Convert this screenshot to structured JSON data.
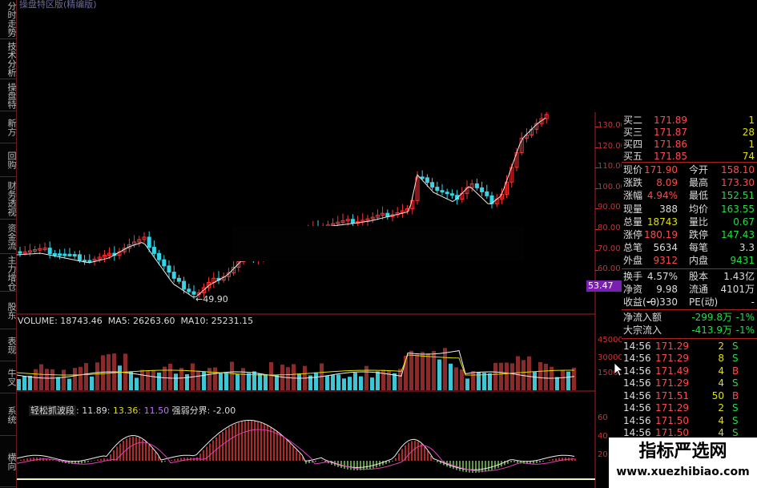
{
  "window": {
    "title": "操盘特区版(精编版)"
  },
  "left_tabs": [
    {
      "label": "分时走势"
    },
    {
      "label": "技术分析",
      "active": true
    },
    {
      "label": "操盘特"
    },
    {
      "label": "新方"
    },
    {
      "label": "回购"
    },
    {
      "label": "财务透视"
    },
    {
      "label": "资金流"
    },
    {
      "label": "主力增仓"
    },
    {
      "label": "股东"
    },
    {
      "label": "表现"
    },
    {
      "label": "牛叉"
    },
    {
      "label": "系统"
    },
    {
      "label": "横向"
    }
  ],
  "price_chart": {
    "y_ticks": [
      "130.00",
      "120.00",
      "110.00",
      "100.00",
      "90.00",
      "80.00",
      "70.00",
      "60.00"
    ],
    "low_label": "49.90",
    "current_marker": "53.47"
  },
  "volume_panel": {
    "label": "VOLUME: 18743.46  MA5: 26263.60  MA10: 25231.15",
    "y_ticks": [
      "45000",
      "30000",
      "15000"
    ]
  },
  "indicator_panel": {
    "name": "轻松抓波段",
    "values": [
      {
        "text": ": 11.89",
        "color": "#dddddd"
      },
      {
        "text": ": 13.36",
        "color": "#e0e000"
      },
      {
        "text": ": 11.50",
        "color": "#c070ff"
      },
      {
        "text": " 强弱分界: -2.00",
        "color": "#dddddd"
      }
    ],
    "y_ticks": [
      "60",
      "40",
      "20"
    ]
  },
  "quote": {
    "bids": [
      {
        "label": "买二",
        "price": "171.89",
        "vol": "1"
      },
      {
        "label": "买三",
        "price": "171.87",
        "vol": "28"
      },
      {
        "label": "买四",
        "price": "171.86",
        "vol": "1"
      },
      {
        "label": "买五",
        "price": "171.85",
        "vol": "74"
      }
    ],
    "stats": [
      {
        "l1": "现价",
        "v1": "171.90",
        "c1": "up",
        "l2": "今开",
        "v2": "158.10",
        "c2": "up"
      },
      {
        "l1": "涨跌",
        "v1": "8.09",
        "c1": "up",
        "l2": "最高",
        "v2": "173.30",
        "c2": "up"
      },
      {
        "l1": "涨幅",
        "v1": "4.94%",
        "c1": "up",
        "l2": "最低",
        "v2": "152.51",
        "c2": "dn"
      },
      {
        "l1": "现量",
        "v1": "388",
        "c1": "wh",
        "l2": "均价",
        "v2": "163.55",
        "c2": "dn"
      },
      {
        "l1": "总量",
        "v1": "18743",
        "c1": "yel",
        "l2": "量比",
        "v2": "0.67",
        "c2": "dn"
      },
      {
        "l1": "涨停",
        "v1": "180.19",
        "c1": "up",
        "l2": "跌停",
        "v2": "147.43",
        "c2": "dn"
      },
      {
        "l1": "总笔",
        "v1": "5634",
        "c1": "wh",
        "l2": "每笔",
        "v2": "3.3",
        "c2": "wh"
      },
      {
        "l1": "外盘",
        "v1": "9312",
        "c1": "up",
        "l2": "内盘",
        "v2": "9431",
        "c2": "dn"
      }
    ],
    "turnover": [
      {
        "l1": "换手",
        "v1": "4.57%",
        "l2": "股本",
        "v2": "1.43亿"
      },
      {
        "l1": "净资",
        "v1": "9.98",
        "l2": "流通",
        "v2": "4101万"
      },
      {
        "l1": "收益(一)",
        "v1": "-0.330",
        "l2": "PE(动)",
        "v2": "-"
      }
    ],
    "flows": [
      {
        "label": "净流入额",
        "value": "-299.8万",
        "pct": "-1%"
      },
      {
        "label": "大宗流入",
        "value": "-413.9万",
        "pct": "-1%"
      }
    ]
  },
  "ticks": [
    {
      "time": "14:56",
      "price": "171.29",
      "vol": "2",
      "side": "S"
    },
    {
      "time": "14:56",
      "price": "171.29",
      "vol": "8",
      "side": "S"
    },
    {
      "time": "14:56",
      "price": "171.49",
      "vol": "4",
      "side": "B"
    },
    {
      "time": "14:56",
      "price": "171.29",
      "vol": "4",
      "side": "S"
    },
    {
      "time": "14:56",
      "price": "171.51",
      "vol": "50",
      "side": "B"
    },
    {
      "time": "14:56",
      "price": "171.29",
      "vol": "2",
      "side": "S"
    },
    {
      "time": "14:56",
      "price": "171.50",
      "vol": "4",
      "side": "S"
    },
    {
      "time": "14:56",
      "price": "171.50",
      "vol": "4",
      "side": "S"
    }
  ],
  "watermark": {
    "title": "指标严选网",
    "url": "www.xuezhibiao.com"
  },
  "colors": {
    "up": "#ff3333",
    "down": "#22dd44",
    "vol_up": "#8b2a2a",
    "vol_down": "#3cc6d6",
    "axis": "#aa2222"
  }
}
